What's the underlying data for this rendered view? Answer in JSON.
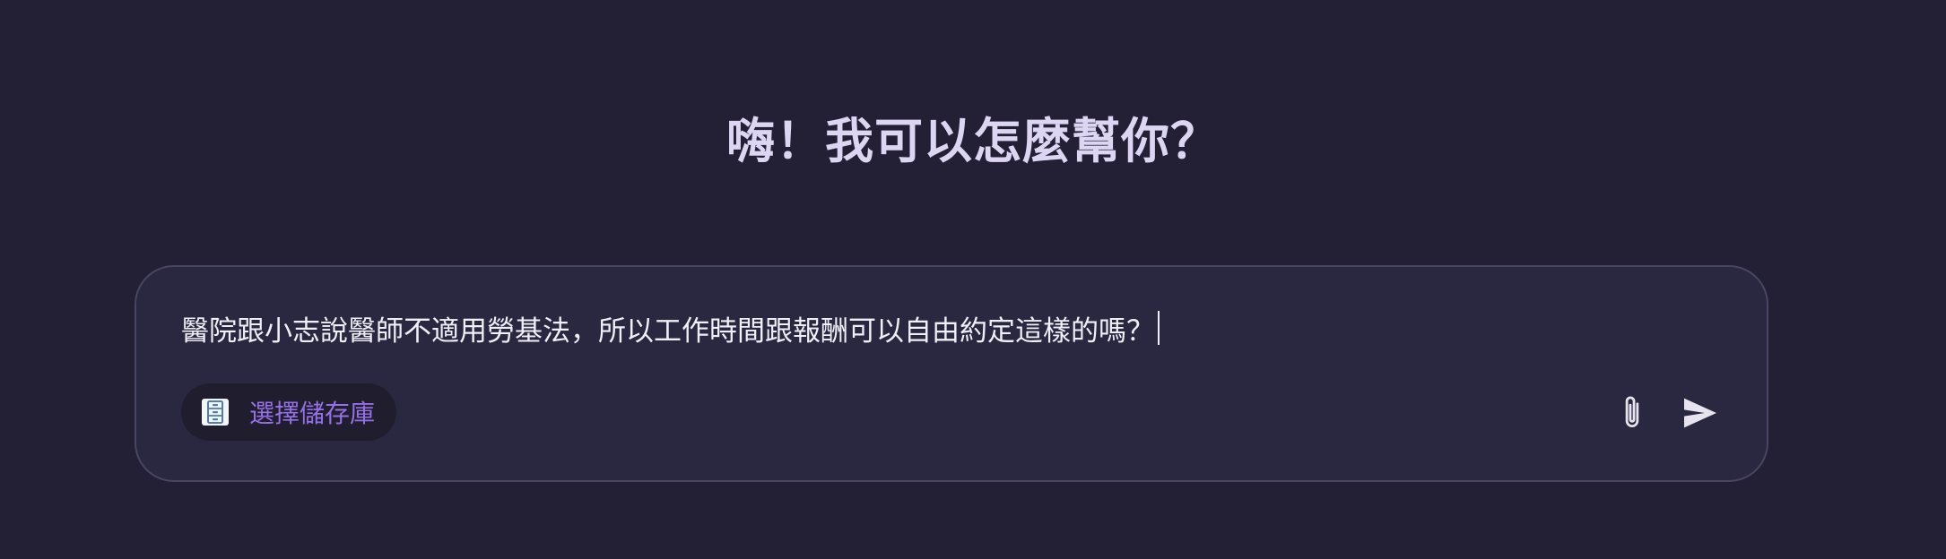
{
  "header": {
    "greeting": "嗨！我可以怎麼幫你？"
  },
  "composer": {
    "input_value": "醫院跟小志說醫師不適用勞基法，所以工作時間跟報酬可以自由約定這樣的嗎？",
    "repo_button_label": "選擇儲存庫",
    "repo_icon": "file-cabinet-icon",
    "attach_icon": "paperclip-icon",
    "send_icon": "send-icon"
  },
  "colors": {
    "background": "#232036",
    "composer_background": "#2a2740",
    "accent": "#9670e6",
    "text": "#f0eef7"
  }
}
